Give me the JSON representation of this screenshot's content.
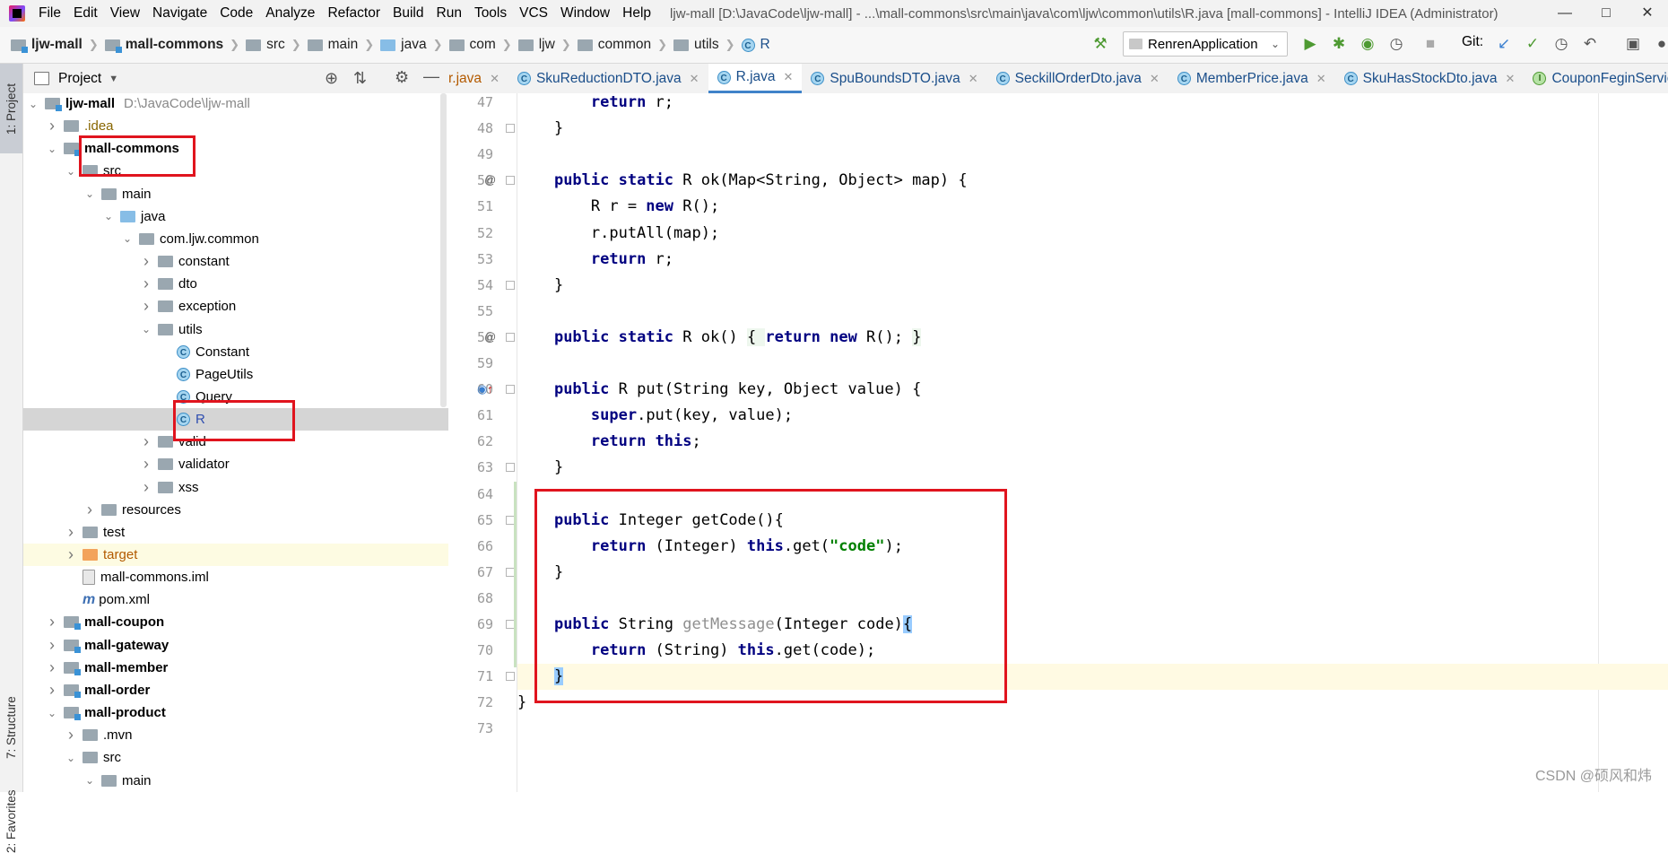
{
  "menu": {
    "items": [
      "File",
      "Edit",
      "View",
      "Navigate",
      "Code",
      "Analyze",
      "Refactor",
      "Build",
      "Run",
      "Tools",
      "VCS",
      "Window",
      "Help"
    ],
    "window_title": "ljw-mall [D:\\JavaCode\\ljw-mall] - ...\\mall-commons\\src\\main\\java\\com\\ljw\\common\\utils\\R.java [mall-commons] - IntelliJ IDEA (Administrator)"
  },
  "breadcrumb": [
    "ljw-mall",
    "mall-commons",
    "src",
    "main",
    "java",
    "com",
    "ljw",
    "common",
    "utils",
    "R"
  ],
  "toolbar": {
    "run_config": "RenrenApplication",
    "git_label": "Git:"
  },
  "sidebar": {
    "project_tab": "1: Project",
    "structure_tab": "7: Structure",
    "favorites_tab": "2: Favorites"
  },
  "project_panel": {
    "title": "Project",
    "tree": [
      {
        "label": "ljw-mall",
        "path": "D:\\JavaCode\\ljw-mall",
        "depth": 0,
        "icon": "module",
        "arrow": "down",
        "bold": true
      },
      {
        "label": ".idea",
        "depth": 1,
        "icon": "folder",
        "arrow": "right",
        "style": "idea"
      },
      {
        "label": "mall-commons",
        "depth": 1,
        "icon": "module",
        "arrow": "down",
        "bold": true
      },
      {
        "label": "src",
        "depth": 2,
        "icon": "folder",
        "arrow": "down"
      },
      {
        "label": "main",
        "depth": 3,
        "icon": "folder",
        "arrow": "down"
      },
      {
        "label": "java",
        "depth": 4,
        "icon": "folder-blue",
        "arrow": "down"
      },
      {
        "label": "com.ljw.common",
        "depth": 5,
        "icon": "folder",
        "arrow": "down"
      },
      {
        "label": "constant",
        "depth": 6,
        "icon": "folder",
        "arrow": "right"
      },
      {
        "label": "dto",
        "depth": 6,
        "icon": "folder",
        "arrow": "right"
      },
      {
        "label": "exception",
        "depth": 6,
        "icon": "folder",
        "arrow": "right"
      },
      {
        "label": "utils",
        "depth": 6,
        "icon": "folder",
        "arrow": "down"
      },
      {
        "label": "Constant",
        "depth": 7,
        "icon": "class",
        "arrow": "none"
      },
      {
        "label": "PageUtils",
        "depth": 7,
        "icon": "class",
        "arrow": "none"
      },
      {
        "label": "Query",
        "depth": 7,
        "icon": "class",
        "arrow": "none"
      },
      {
        "label": "R",
        "depth": 7,
        "icon": "class",
        "arrow": "none",
        "selected": true
      },
      {
        "label": "valid",
        "depth": 6,
        "icon": "folder",
        "arrow": "right"
      },
      {
        "label": "validator",
        "depth": 6,
        "icon": "folder",
        "arrow": "right"
      },
      {
        "label": "xss",
        "depth": 6,
        "icon": "folder",
        "arrow": "right"
      },
      {
        "label": "resources",
        "depth": 3,
        "icon": "folder",
        "arrow": "right"
      },
      {
        "label": "test",
        "depth": 2,
        "icon": "folder",
        "arrow": "right"
      },
      {
        "label": "target",
        "depth": 2,
        "icon": "folder-orange",
        "arrow": "right",
        "excluded": true
      },
      {
        "label": "mall-commons.iml",
        "depth": 2,
        "icon": "file",
        "arrow": "none"
      },
      {
        "label": "pom.xml",
        "depth": 2,
        "icon": "maven",
        "arrow": "none"
      },
      {
        "label": "mall-coupon",
        "depth": 1,
        "icon": "module",
        "arrow": "right",
        "bold": true
      },
      {
        "label": "mall-gateway",
        "depth": 1,
        "icon": "module",
        "arrow": "right",
        "bold": true
      },
      {
        "label": "mall-member",
        "depth": 1,
        "icon": "module",
        "arrow": "right",
        "bold": true
      },
      {
        "label": "mall-order",
        "depth": 1,
        "icon": "module",
        "arrow": "right",
        "bold": true
      },
      {
        "label": "mall-product",
        "depth": 1,
        "icon": "module",
        "arrow": "down",
        "bold": true
      },
      {
        "label": ".mvn",
        "depth": 2,
        "icon": "folder",
        "arrow": "right"
      },
      {
        "label": "src",
        "depth": 2,
        "icon": "folder",
        "arrow": "down"
      },
      {
        "label": "main",
        "depth": 3,
        "icon": "folder",
        "arrow": "down"
      }
    ]
  },
  "editor": {
    "tabs": [
      {
        "label": "r.java",
        "icon": "none",
        "partial": true
      },
      {
        "label": "SkuReductionDTO.java",
        "icon": "class"
      },
      {
        "label": "R.java",
        "icon": "class",
        "active": true
      },
      {
        "label": "SpuBoundsDTO.java",
        "icon": "class"
      },
      {
        "label": "SeckillOrderDto.java",
        "icon": "class"
      },
      {
        "label": "MemberPrice.java",
        "icon": "class"
      },
      {
        "label": "SkuHasStockDto.java",
        "icon": "class"
      },
      {
        "label": "CouponFeginService.jav",
        "icon": "interface"
      }
    ],
    "lines": [
      {
        "n": "47",
        "code": "        return r;"
      },
      {
        "n": "48",
        "code": "    }"
      },
      {
        "n": "49",
        "code": ""
      },
      {
        "n": "50",
        "code": "    public static R ok(Map<String, Object> map) {",
        "mark": "@"
      },
      {
        "n": "51",
        "code": "        R r = new R();"
      },
      {
        "n": "52",
        "code": "        r.putAll(map);"
      },
      {
        "n": "53",
        "code": "        return r;"
      },
      {
        "n": "54",
        "code": "    }"
      },
      {
        "n": "55",
        "code": ""
      },
      {
        "n": "56",
        "code": "    public static R ok() { return new R(); }",
        "mark": "@"
      },
      {
        "n": "59",
        "code": ""
      },
      {
        "n": "60",
        "code": "    public R put(String key, Object value) {",
        "mark": "override"
      },
      {
        "n": "61",
        "code": "        super.put(key, value);"
      },
      {
        "n": "62",
        "code": "        return this;"
      },
      {
        "n": "63",
        "code": "    }"
      },
      {
        "n": "64",
        "code": ""
      },
      {
        "n": "65",
        "code": "    public Integer getCode(){"
      },
      {
        "n": "66",
        "code": "        return (Integer) this.get(\"code\");"
      },
      {
        "n": "67",
        "code": "    }"
      },
      {
        "n": "68",
        "code": ""
      },
      {
        "n": "69",
        "code": "    public String getMessage(Integer code){"
      },
      {
        "n": "70",
        "code": "        return (String) this.get(code);"
      },
      {
        "n": "71",
        "code": "    }",
        "current": true
      },
      {
        "n": "72",
        "code": "}"
      },
      {
        "n": "73",
        "code": ""
      }
    ]
  },
  "watermark": "CSDN @硕风和炜",
  "colors": {
    "keyword": "#000080",
    "string": "#008000",
    "highlight_box": "#e0141e",
    "selection": "#d5d5d5",
    "current_line": "#fffae3"
  }
}
